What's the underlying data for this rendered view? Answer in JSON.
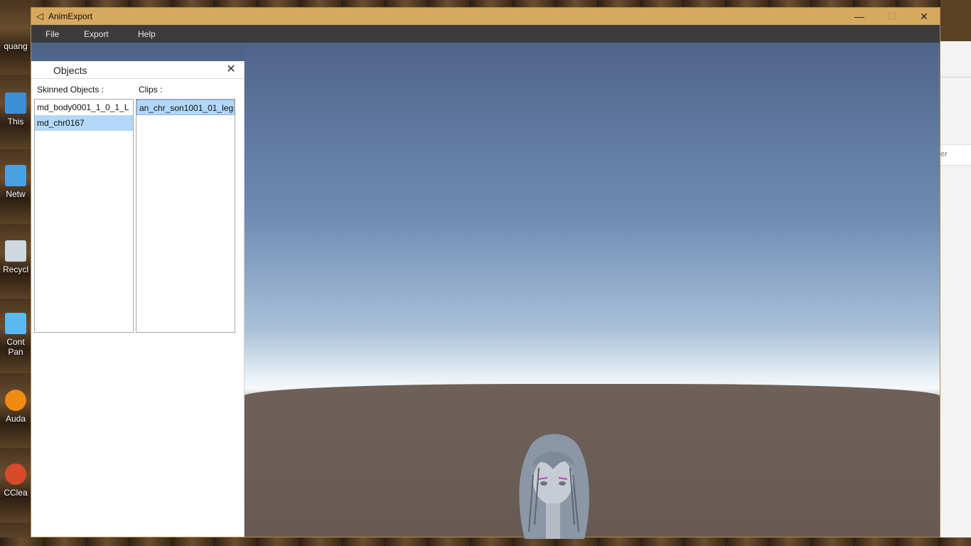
{
  "window": {
    "title": "AnimExport"
  },
  "menu": {
    "items": [
      "File",
      "Export",
      "Help"
    ]
  },
  "controls": {
    "minimize": "—",
    "maximize": "☐",
    "close": "✕"
  },
  "objects_panel": {
    "title": "Objects",
    "close_glyph": "✕",
    "skinned_label": "Skinned Objects :",
    "clips_label": "Clips :",
    "skinned_objects": [
      "md_body0001_1_0_1_L",
      "md_chr0167"
    ],
    "selected_skinned_index": 1,
    "clips": [
      "an_chr_son1001_01_leg"
    ],
    "selected_clip_index": 0
  },
  "desktop": {
    "icons": [
      "quang",
      "This",
      "Netw",
      "Recycl",
      "Cont Pan",
      "Auda",
      "CClea"
    ],
    "bg_window_text": "er"
  },
  "colors": {
    "titlebar": "#d6a95f",
    "menubar": "#3b3b3b",
    "selection": "#b3d8f7"
  }
}
